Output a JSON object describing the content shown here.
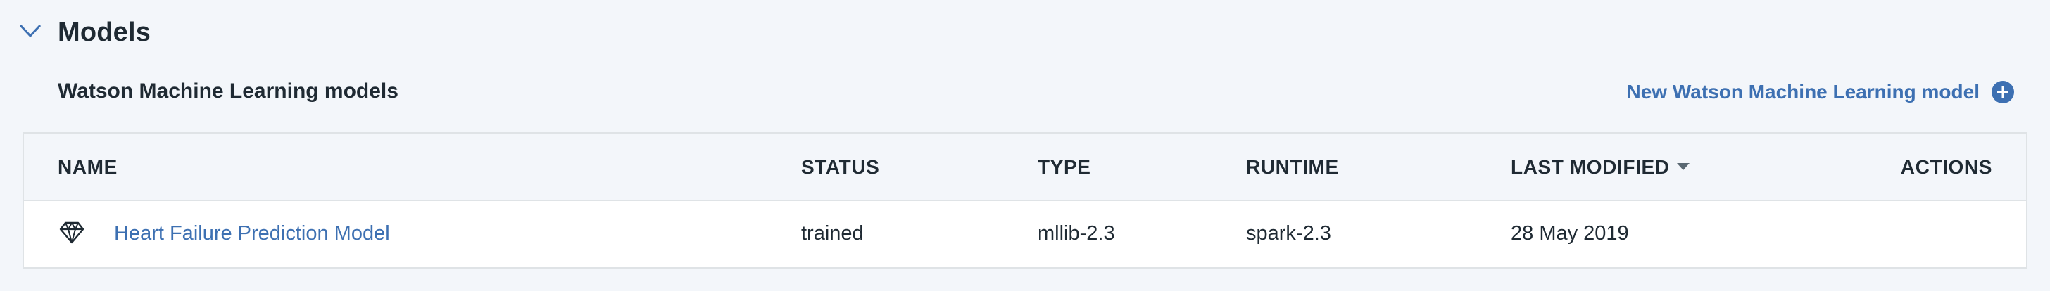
{
  "section": {
    "title": "Models"
  },
  "subheader": {
    "title": "Watson Machine Learning models",
    "new_model_label": "New Watson Machine Learning model"
  },
  "table": {
    "headers": {
      "name": "NAME",
      "status": "STATUS",
      "type": "TYPE",
      "runtime": "RUNTIME",
      "last_modified": "LAST MODIFIED",
      "actions": "ACTIONS"
    },
    "sort": {
      "column": "last_modified",
      "direction": "descending"
    },
    "rows": [
      {
        "icon": "model-diamond-icon",
        "name": "Heart Failure Prediction Model",
        "status": "trained",
        "type": "mllib-2.3",
        "runtime": "spark-2.3",
        "last_modified": "28 May 2019"
      }
    ]
  },
  "colors": {
    "background": "#f3f6fa",
    "link": "#3d70b2",
    "text": "#1f2a33",
    "border": "#dfe3e6"
  }
}
